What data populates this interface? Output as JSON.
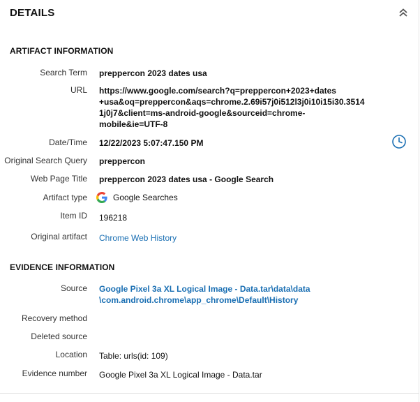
{
  "panel": {
    "title": "DETAILS"
  },
  "artifact_section": {
    "title": "ARTIFACT INFORMATION",
    "fields": {
      "search_term": {
        "label": "Search Term",
        "value": "preppercon 2023 dates usa"
      },
      "url": {
        "label": "URL",
        "line1": "https://www.google.com/search?q=preppercon+2023+dates",
        "line2": "+usa&oq=preppercon&aqs=chrome.2.69i57j0i512l3j0i10i15i30.3514",
        "line3": "1j0j7&client=ms-android-google&sourceid=chrome-",
        "line4": "mobile&ie=UTF-8"
      },
      "date_time": {
        "label": "Date/Time",
        "value": "12/22/2023 5:07:47.150 PM"
      },
      "original_search_query": {
        "label": "Original Search Query",
        "value": "preppercon"
      },
      "web_page_title": {
        "label": "Web Page Title",
        "value": "preppercon 2023 dates usa - Google Search"
      },
      "artifact_type": {
        "label": "Artifact type",
        "value": "Google Searches"
      },
      "item_id": {
        "label": "Item ID",
        "value": "196218"
      },
      "original_artifact": {
        "label": "Original artifact",
        "value": "Chrome Web History"
      }
    }
  },
  "evidence_section": {
    "title": "EVIDENCE INFORMATION",
    "fields": {
      "source": {
        "label": "Source",
        "line1": "Google Pixel 3a XL Logical Image - Data.tar\\data\\data",
        "line2": "\\com.android.chrome\\app_chrome\\Default\\History"
      },
      "recovery_method": {
        "label": "Recovery method",
        "value": ""
      },
      "deleted_source": {
        "label": "Deleted source",
        "value": ""
      },
      "location": {
        "label": "Location",
        "value": "Table: urls(id: 109)"
      },
      "evidence_number": {
        "label": "Evidence number",
        "value": "Google Pixel 3a XL Logical Image - Data.tar"
      }
    }
  },
  "icons": {
    "collapse": "double-chevron-up-icon",
    "clock": "clock-icon",
    "google": "google-g-icon"
  },
  "colors": {
    "link": "#1a6fb3",
    "clock": "#1a6fb3"
  }
}
